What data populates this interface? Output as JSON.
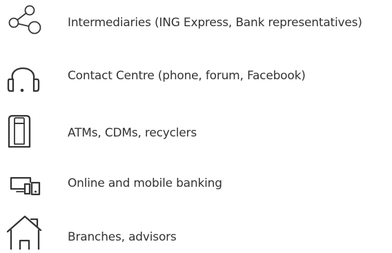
{
  "channels": {
    "items": [
      {
        "icon": "share-network-icon",
        "label": "Intermediaries (ING Express, Bank representatives)"
      },
      {
        "icon": "headset-icon",
        "label": "Contact Centre (phone, forum, Facebook)"
      },
      {
        "icon": "atm-machine-icon",
        "label": "ATMs, CDMs, recyclers"
      },
      {
        "icon": "devices-icon",
        "label": "Online and mobile banking"
      },
      {
        "icon": "house-icon",
        "label": "Branches, advisors"
      }
    ]
  },
  "colors": {
    "text": "#333333",
    "icon": "#333333",
    "background": "#ffffff"
  }
}
